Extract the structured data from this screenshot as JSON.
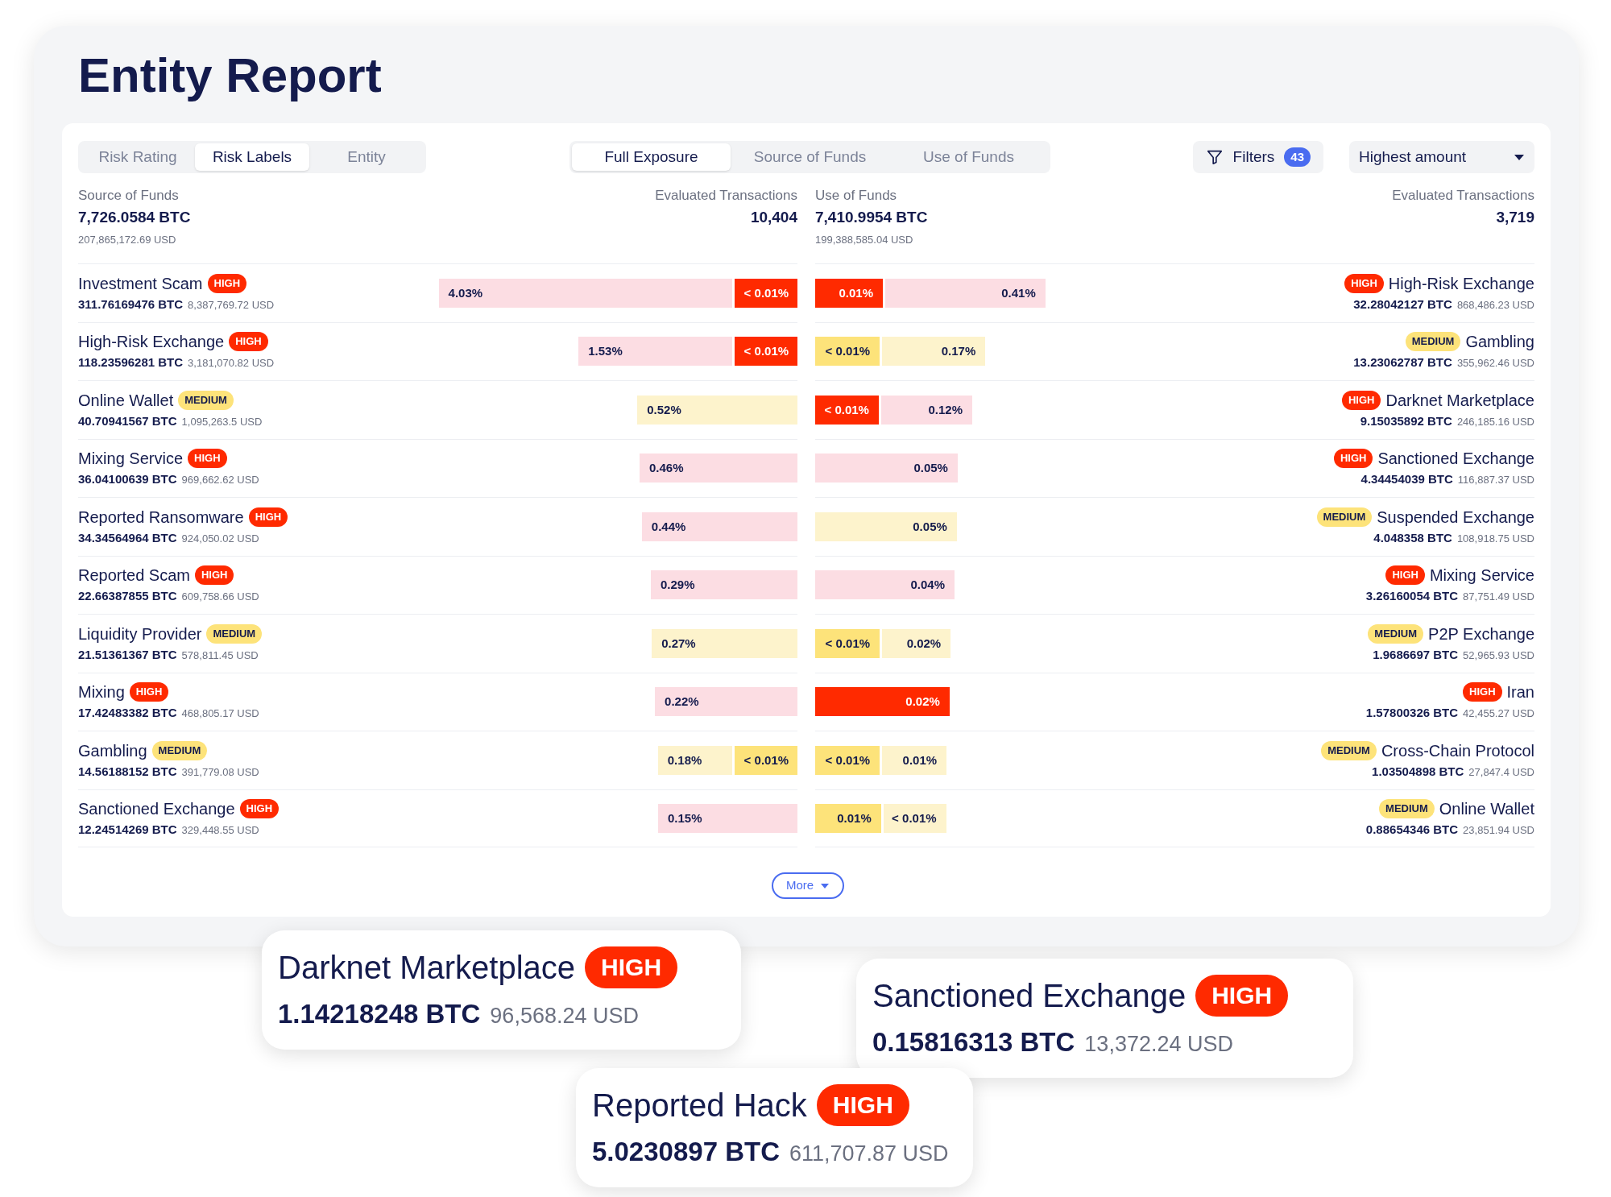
{
  "title": "Entity Report",
  "view_tabs": [
    {
      "label": "Risk Rating",
      "selected": false
    },
    {
      "label": "Risk Labels",
      "selected": true
    },
    {
      "label": "Entity",
      "selected": false
    }
  ],
  "exposure_tabs": [
    {
      "label": "Full Exposure",
      "selected": true
    },
    {
      "label": "Source of Funds",
      "selected": false
    },
    {
      "label": "Use of Funds",
      "selected": false
    }
  ],
  "filters": {
    "label": "Filters",
    "count": "43"
  },
  "sort": {
    "value": "Highest amount"
  },
  "source": {
    "heading": "Source of Funds",
    "btc": "7,726.0584 BTC",
    "usd": "207,865,172.69 USD",
    "tx_heading": "Evaluated Transactions",
    "tx_count": "10,404",
    "rows": [
      {
        "name": "Investment Scam",
        "kind": "high",
        "badge": "HIGH",
        "btc": "311.76169476 BTC",
        "usd": "8,387,769.72 USD",
        "segments": [
          {
            "label": "4.03%",
            "kind": "high",
            "strong": false
          },
          {
            "label": "< 0.01%",
            "kind": "high",
            "strong": true
          }
        ]
      },
      {
        "name": "High-Risk Exchange",
        "kind": "high",
        "badge": "HIGH",
        "btc": "118.23596281 BTC",
        "usd": "3,181,070.82 USD",
        "segments": [
          {
            "label": "1.53%",
            "kind": "high",
            "strong": false
          },
          {
            "label": "< 0.01%",
            "kind": "high",
            "strong": true
          }
        ]
      },
      {
        "name": "Online Wallet",
        "kind": "medium",
        "badge": "MEDIUM",
        "btc": "40.70941567 BTC",
        "usd": "1,095,263.5 USD",
        "segments": [
          {
            "label": "0.52%",
            "kind": "medium",
            "strong": false
          }
        ]
      },
      {
        "name": "Mixing Service",
        "kind": "high",
        "badge": "HIGH",
        "btc": "36.04100639 BTC",
        "usd": "969,662.62 USD",
        "segments": [
          {
            "label": "0.46%",
            "kind": "high",
            "strong": false
          }
        ]
      },
      {
        "name": "Reported Ransomware",
        "kind": "high",
        "badge": "HIGH",
        "btc": "34.34564964 BTC",
        "usd": "924,050.02 USD",
        "segments": [
          {
            "label": "0.44%",
            "kind": "high",
            "strong": false
          }
        ]
      },
      {
        "name": "Reported Scam",
        "kind": "high",
        "badge": "HIGH",
        "btc": "22.66387855 BTC",
        "usd": "609,758.66 USD",
        "segments": [
          {
            "label": "0.29%",
            "kind": "high",
            "strong": false
          }
        ]
      },
      {
        "name": "Liquidity Provider",
        "kind": "medium",
        "badge": "MEDIUM",
        "btc": "21.51361367 BTC",
        "usd": "578,811.45 USD",
        "segments": [
          {
            "label": "0.27%",
            "kind": "medium",
            "strong": false
          }
        ]
      },
      {
        "name": "Mixing",
        "kind": "high",
        "badge": "HIGH",
        "btc": "17.42483382 BTC",
        "usd": "468,805.17 USD",
        "segments": [
          {
            "label": "0.22%",
            "kind": "high",
            "strong": false
          }
        ]
      },
      {
        "name": "Gambling",
        "kind": "medium",
        "badge": "MEDIUM",
        "btc": "14.56188152 BTC",
        "usd": "391,779.08 USD",
        "segments": [
          {
            "label": "0.18%",
            "kind": "medium",
            "strong": false
          },
          {
            "label": "< 0.01%",
            "kind": "medium",
            "strong": true
          }
        ]
      },
      {
        "name": "Sanctioned Exchange",
        "kind": "high",
        "badge": "HIGH",
        "btc": "12.24514269 BTC",
        "usd": "329,448.55 USD",
        "segments": [
          {
            "label": "0.15%",
            "kind": "high",
            "strong": false
          }
        ]
      }
    ]
  },
  "use": {
    "heading": "Use of Funds",
    "btc": "7,410.9954 BTC",
    "usd": "199,388,585.04 USD",
    "tx_heading": "Evaluated Transactions",
    "tx_count": "3,719",
    "rows": [
      {
        "name": "High-Risk Exchange",
        "kind": "high",
        "badge": "HIGH",
        "btc": "32.28042127 BTC",
        "usd": "868,486.23 USD",
        "segments": [
          {
            "label": "0.01%",
            "kind": "high",
            "strong": true
          },
          {
            "label": "0.41%",
            "kind": "high",
            "strong": false
          }
        ]
      },
      {
        "name": "Gambling",
        "kind": "medium",
        "badge": "MEDIUM",
        "btc": "13.23062787 BTC",
        "usd": "355,962.46 USD",
        "segments": [
          {
            "label": "< 0.01%",
            "kind": "medium",
            "strong": true
          },
          {
            "label": "0.17%",
            "kind": "medium",
            "strong": false
          }
        ]
      },
      {
        "name": "Darknet Marketplace",
        "kind": "high",
        "badge": "HIGH",
        "btc": "9.15035892 BTC",
        "usd": "246,185.16 USD",
        "segments": [
          {
            "label": "< 0.01%",
            "kind": "high",
            "strong": true
          },
          {
            "label": "0.12%",
            "kind": "high",
            "strong": false
          }
        ]
      },
      {
        "name": "Sanctioned Exchange",
        "kind": "high",
        "badge": "HIGH",
        "btc": "4.34454039 BTC",
        "usd": "116,887.37 USD",
        "segments": [
          {
            "label": "0.05%",
            "kind": "high",
            "strong": false
          }
        ]
      },
      {
        "name": "Suspended Exchange",
        "kind": "medium",
        "badge": "MEDIUM",
        "btc": "4.048358 BTC",
        "usd": "108,918.75 USD",
        "segments": [
          {
            "label": "0.05%",
            "kind": "medium",
            "strong": false
          }
        ]
      },
      {
        "name": "Mixing Service",
        "kind": "high",
        "badge": "HIGH",
        "btc": "3.26160054 BTC",
        "usd": "87,751.49 USD",
        "segments": [
          {
            "label": "0.04%",
            "kind": "high",
            "strong": false
          }
        ]
      },
      {
        "name": "P2P Exchange",
        "kind": "medium",
        "badge": "MEDIUM",
        "btc": "1.9686697 BTC",
        "usd": "52,965.93 USD",
        "segments": [
          {
            "label": "< 0.01%",
            "kind": "medium",
            "strong": true
          },
          {
            "label": "0.02%",
            "kind": "medium",
            "strong": false
          }
        ]
      },
      {
        "name": "Iran",
        "kind": "high",
        "badge": "HIGH",
        "btc": "1.57800326 BTC",
        "usd": "42,455.27 USD",
        "segments": [
          {
            "label": "0.02%",
            "kind": "high",
            "strong": true
          }
        ]
      },
      {
        "name": "Cross-Chain Protocol",
        "kind": "medium",
        "badge": "MEDIUM",
        "btc": "1.03504898 BTC",
        "usd": "27,847.4 USD",
        "segments": [
          {
            "label": "< 0.01%",
            "kind": "medium",
            "strong": true
          },
          {
            "label": "0.01%",
            "kind": "medium",
            "strong": false
          }
        ]
      },
      {
        "name": "Online Wallet",
        "kind": "medium",
        "badge": "MEDIUM",
        "btc": "0.88654346 BTC",
        "usd": "23,851.94 USD",
        "segments": [
          {
            "label": "0.01%",
            "kind": "medium",
            "strong": true
          },
          {
            "label": "< 0.01%",
            "kind": "medium",
            "strong": false
          }
        ]
      }
    ]
  },
  "more_button": "More",
  "highlight_cards": [
    {
      "name": "Darknet Marketplace",
      "kind": "high",
      "badge": "HIGH",
      "btc": "1.14218248 BTC",
      "usd": "96,568.24 USD"
    },
    {
      "name": "Sanctioned Exchange",
      "kind": "high",
      "badge": "HIGH",
      "btc": "0.15816313 BTC",
      "usd": "13,372.24 USD"
    },
    {
      "name": "Reported Hack",
      "kind": "high",
      "badge": "HIGH",
      "btc": "5.0230897 BTC",
      "usd": "611,707.87 USD"
    }
  ]
}
